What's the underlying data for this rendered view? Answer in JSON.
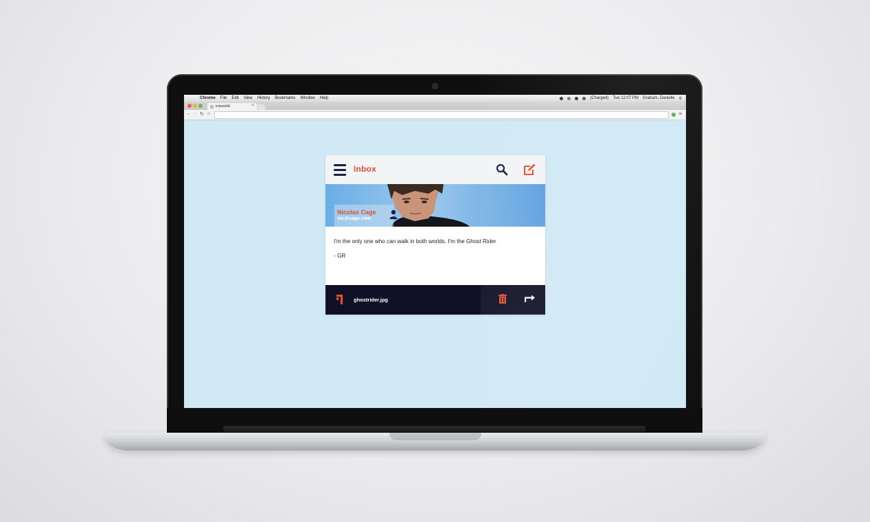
{
  "menubar": {
    "apple_glyph": "",
    "app_name": "Chrome",
    "items": [
      "File",
      "Edit",
      "View",
      "History",
      "Bookmarks",
      "Window",
      "Help"
    ],
    "battery": "(Charged)",
    "clock": "Tue 12:07 PM",
    "user": "Graham, Danielle"
  },
  "browser": {
    "tab_title": "trdaniiellk"
  },
  "mail": {
    "title": "Inbox",
    "accent_color": "#e2512e",
    "navy_color": "#1b1f45",
    "sender": {
      "name": "Nicolas Cage",
      "email": "nic@cage.com"
    },
    "body": "I'm the only one who can walk in both worlds. I'm the Ghost Rider",
    "signature": "- GR",
    "attachment": {
      "filename": "ghostrider.jpg"
    }
  },
  "icons": {
    "menu": "hamburger-icon",
    "search": "search-icon",
    "compose": "compose-icon",
    "contact": "contact-icon",
    "attachment": "attachment-icon",
    "delete": "trash-icon",
    "forward": "forward-icon"
  }
}
